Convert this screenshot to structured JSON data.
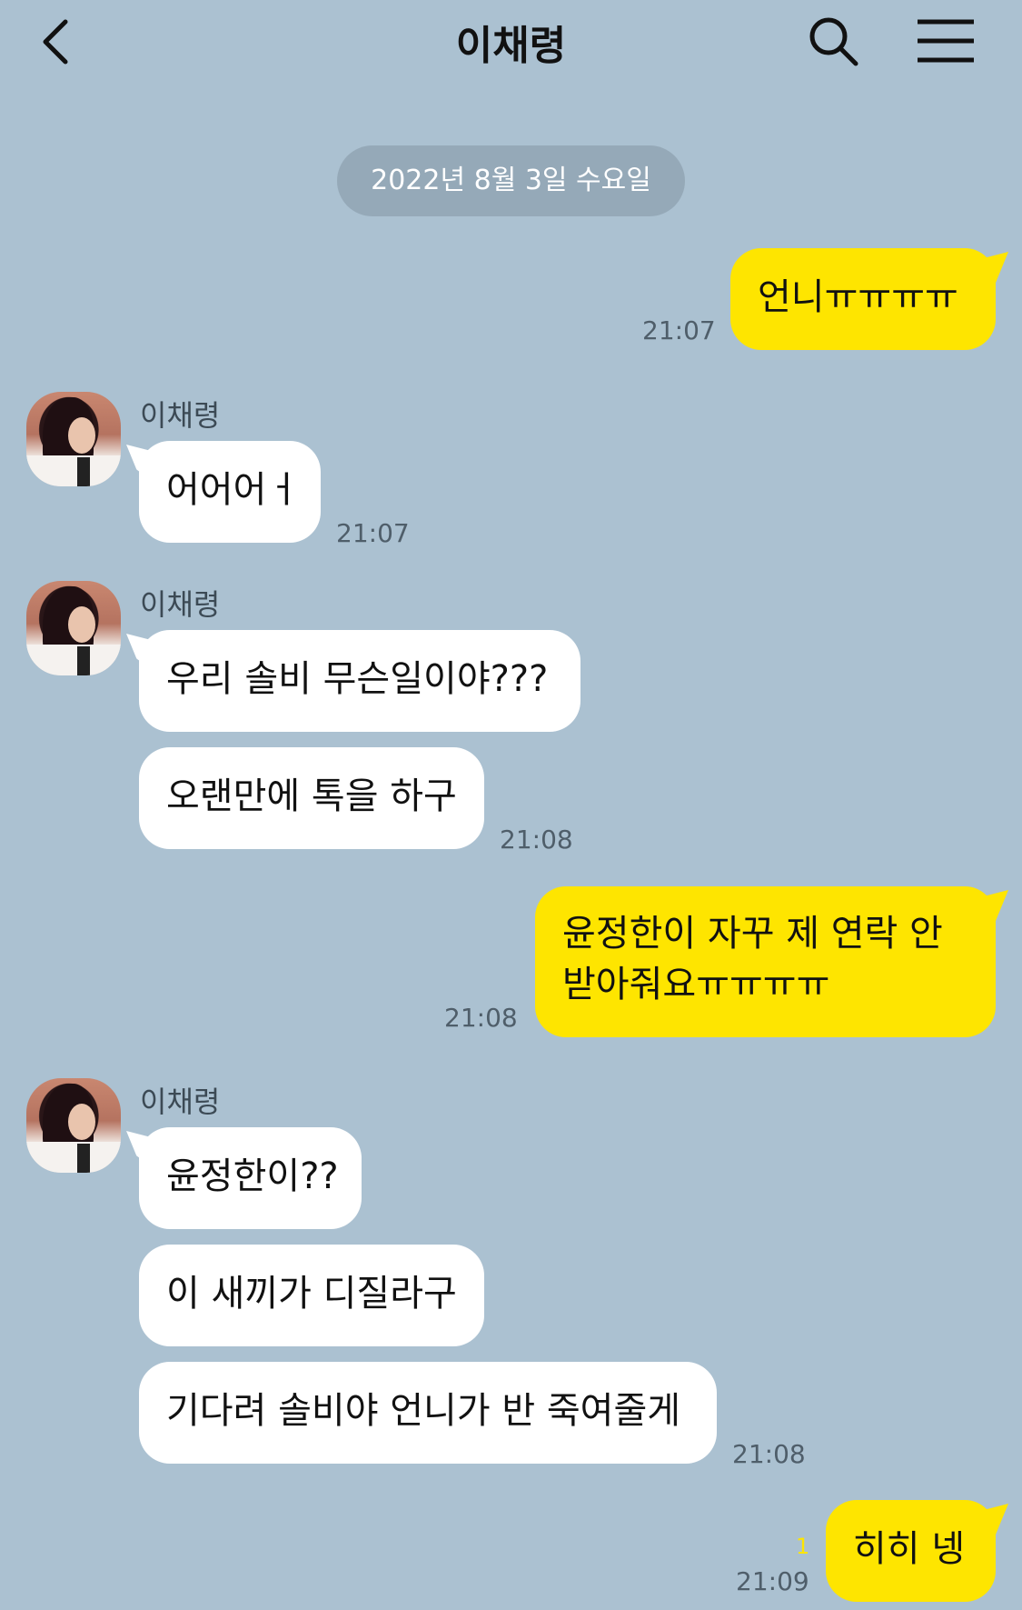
{
  "header": {
    "title": "이채령"
  },
  "date_divider": "2022년 8월 3일 수요일",
  "messages": [
    {
      "id": "m1",
      "direction": "out",
      "text": "언니ㅠㅠㅠㅠ",
      "time": "21:07"
    },
    {
      "id": "m2",
      "direction": "in",
      "sender": "이채령",
      "text": "어어어ㅓ",
      "time": "21:07"
    },
    {
      "id": "m3",
      "direction": "in",
      "sender": "이채령",
      "text": "우리 솔비 무슨일이야???"
    },
    {
      "id": "m4",
      "direction": "in",
      "text": "오랜만에 톡을 하구",
      "time": "21:08"
    },
    {
      "id": "m5",
      "direction": "out",
      "text_line1": "윤정한이 자꾸 제 연락 안",
      "text_line2": "받아줘요ㅠㅠㅠㅠ",
      "time": "21:08"
    },
    {
      "id": "m6",
      "direction": "in",
      "sender": "이채령",
      "text": "윤정한이??"
    },
    {
      "id": "m7",
      "direction": "in",
      "text": "이 새끼가 디질라구"
    },
    {
      "id": "m8",
      "direction": "in",
      "text": "기다려 솔비야 언니가 반 죽여줄게",
      "time": "21:08"
    },
    {
      "id": "m9",
      "direction": "out",
      "text": "히히 넹",
      "time": "21:09",
      "unread": "1"
    }
  ],
  "colors": {
    "background": "#abc1d1",
    "my_bubble": "#fee500",
    "their_bubble": "#ffffff",
    "date_pill": "#95a9b8"
  },
  "icons": [
    "back-arrow-icon",
    "search-icon",
    "hamburger-menu-icon"
  ]
}
